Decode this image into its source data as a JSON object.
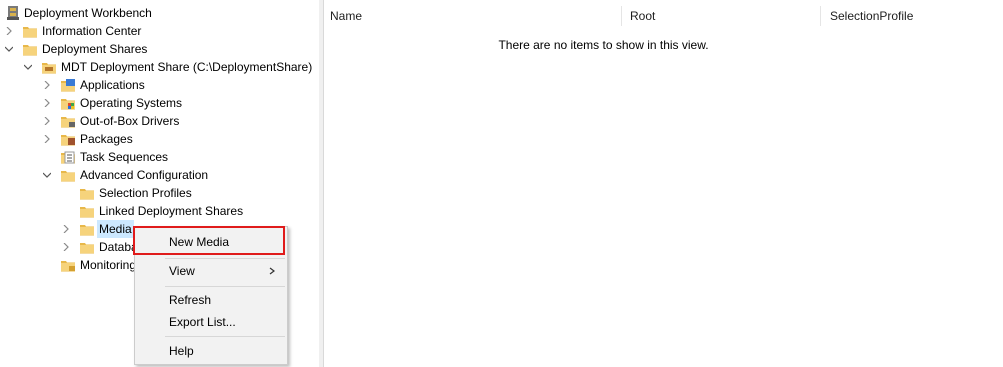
{
  "tree": {
    "root": "Deployment Workbench",
    "information_center": "Information Center",
    "deployment_shares": "Deployment Shares",
    "mdt_share": "MDT Deployment Share (C:\\DeploymentShare)",
    "applications": "Applications",
    "operating_systems": "Operating Systems",
    "drivers": "Out-of-Box Drivers",
    "packages": "Packages",
    "task_sequences": "Task Sequences",
    "advanced_configuration": "Advanced Configuration",
    "selection_profiles": "Selection Profiles",
    "linked_shares": "Linked Deployment Shares",
    "media": "Media",
    "database": "Database",
    "monitoring": "Monitoring"
  },
  "list": {
    "columns": [
      "Name",
      "Root",
      "SelectionProfile"
    ],
    "empty_message": "There are no items to show in this view."
  },
  "context_menu": {
    "new_media": "New Media",
    "view": "View",
    "refresh": "Refresh",
    "export_list": "Export List...",
    "help": "Help"
  },
  "colors": {
    "selection": "#cce8ff",
    "folder": "#e8b84a",
    "highlight_box": "#e01b1b"
  }
}
